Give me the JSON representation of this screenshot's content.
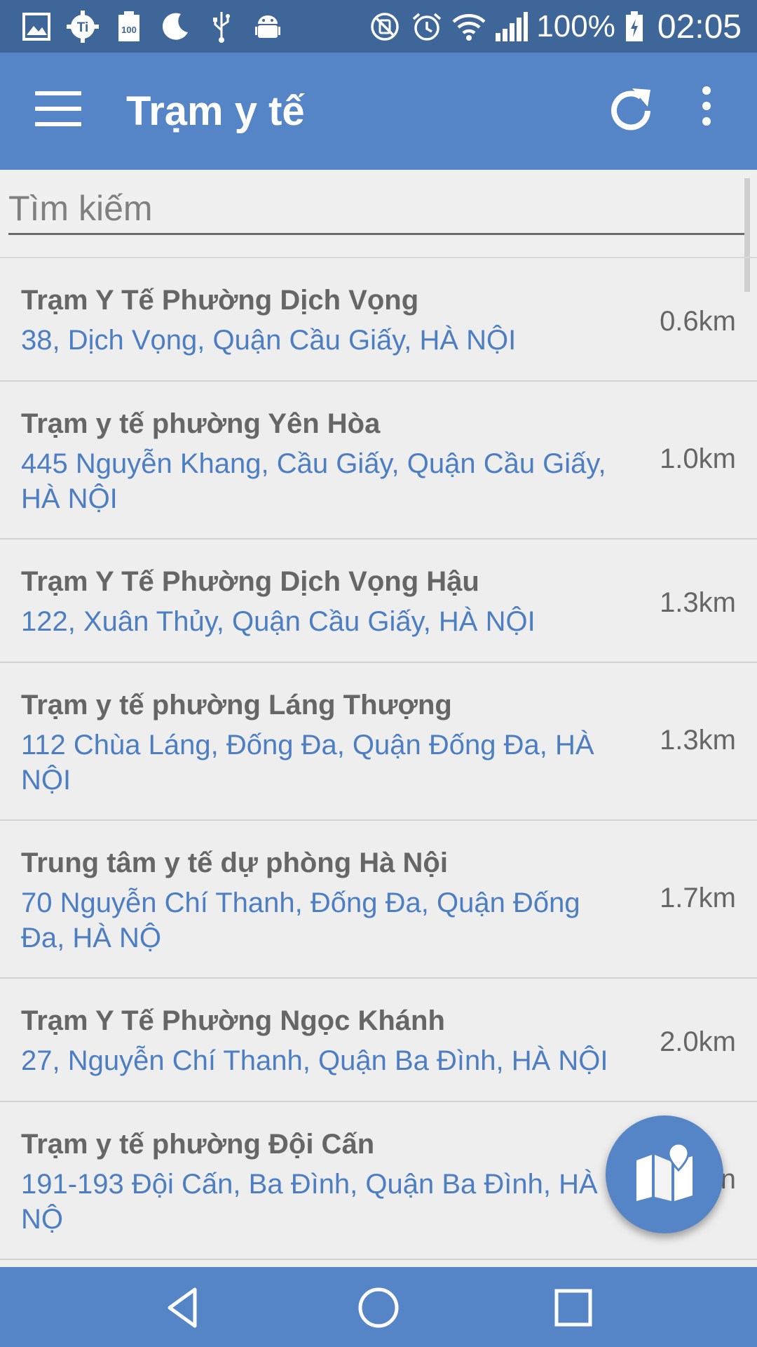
{
  "status_bar": {
    "left_icons": [
      "image-icon",
      "ti-settings-icon",
      "battery-saver-icon",
      "moon-icon",
      "usb-icon",
      "android-debug-icon"
    ],
    "right_icons": [
      "mute-icon",
      "alarm-icon",
      "wifi-icon",
      "signal-icon"
    ],
    "battery_percent": "100%",
    "time": "02:05"
  },
  "app_bar": {
    "title": "Trạm y tế",
    "icons": [
      "menu-icon",
      "refresh-icon",
      "more-vert-icon"
    ]
  },
  "search": {
    "placeholder": "Tìm kiếm"
  },
  "list": [
    {
      "name": "Trạm Y Tế Phường Dịch Vọng",
      "address": "38, Dịch Vọng, Quận Cầu Giấy, HÀ NỘI",
      "distance": "0.6km"
    },
    {
      "name": "Trạm y tế phường Yên Hòa",
      "address": "445 Nguyễn Khang, Cầu Giấy, Quận Cầu Giấy, HÀ NỘI",
      "distance": "1.0km"
    },
    {
      "name": "Trạm Y Tế Phường Dịch Vọng Hậu",
      "address": "122, Xuân Thủy, Quận Cầu Giấy, HÀ NỘI",
      "distance": "1.3km"
    },
    {
      "name": "Trạm y tế phường Láng Thượng",
      "address": "112 Chùa Láng, Đống Đa, Quận Đống Đa, HÀ NỘI",
      "distance": "1.3km"
    },
    {
      "name": "Trung tâm y tế dự phòng Hà Nội",
      "address": "70 Nguyễn Chí Thanh, Đống Đa, Quận Đống Đa, HÀ NỘ",
      "distance": "1.7km"
    },
    {
      "name": "Trạm Y Tế Phường Ngọc Khánh",
      "address": "27, Nguyễn Chí Thanh, Quận Ba Đình, HÀ NỘI",
      "distance": "2.0km"
    },
    {
      "name": "Trạm y tế phường Đội Cấn",
      "address": "191-193 Đội Cấn, Ba Đình, Quận Ba Đình, HÀ NỘ",
      "distance": "n"
    }
  ],
  "fab": {
    "icon": "map-icon"
  },
  "nav_bar": {
    "icons": [
      "back-icon",
      "home-icon",
      "recents-icon"
    ]
  },
  "colors": {
    "status_bar": "#3f6699",
    "app_bar": "#5585c6",
    "address_text": "#4d7ec2",
    "background": "#eeeeef"
  }
}
